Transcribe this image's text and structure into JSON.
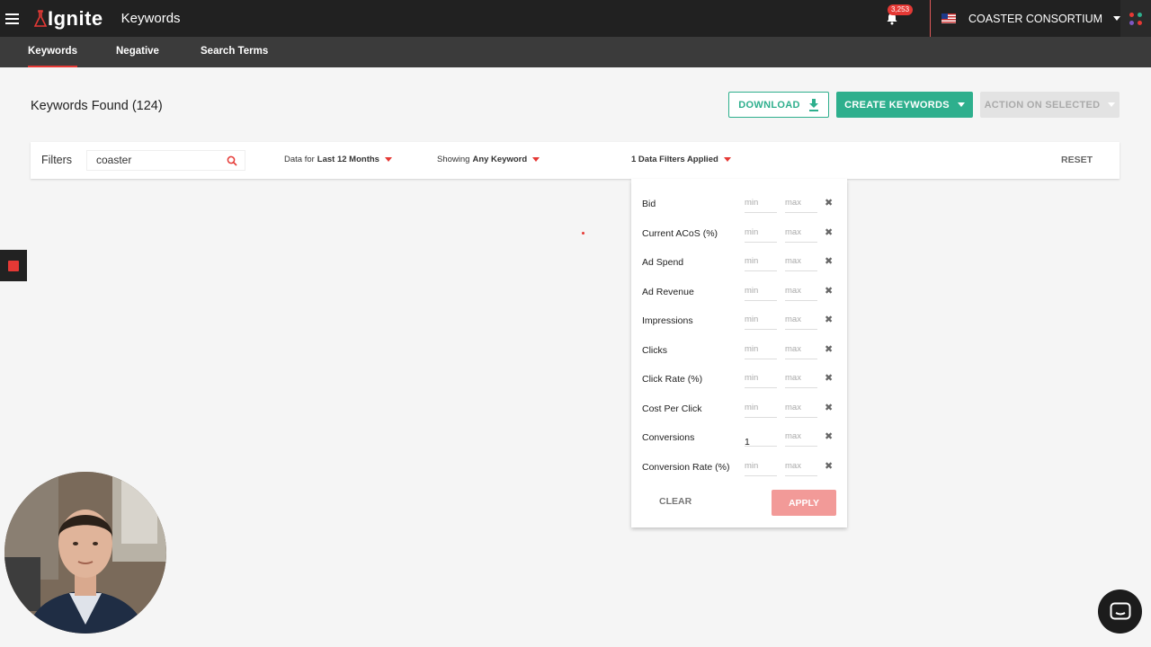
{
  "app": {
    "logo": "Ignite",
    "page_heading": "Keywords",
    "notification_count": "3,253",
    "account_name": "COASTER CONSORTIUM"
  },
  "tabs": [
    {
      "label": "Keywords",
      "active": true
    },
    {
      "label": "Negative",
      "active": false
    },
    {
      "label": "Search Terms",
      "active": false
    }
  ],
  "header": {
    "title": "Keywords Found (124)",
    "download_label": "DOWNLOAD",
    "create_label": "CREATE KEYWORDS",
    "action_label": "ACTION ON SELECTED"
  },
  "filters": {
    "label": "Filters",
    "search_value": "coaster",
    "data_for_prefix": "Data for",
    "data_for_value": "Last 12 Months",
    "showing_prefix": "Showing",
    "showing_value": "Any Keyword",
    "applied_label": "1 Data Filters Applied",
    "reset_label": "RESET"
  },
  "data_filters": {
    "min_placeholder": "min",
    "max_placeholder": "max",
    "rows": [
      {
        "label": "Bid",
        "min": "",
        "max": ""
      },
      {
        "label": "Current ACoS (%)",
        "min": "",
        "max": ""
      },
      {
        "label": "Ad Spend",
        "min": "",
        "max": ""
      },
      {
        "label": "Ad Revenue",
        "min": "",
        "max": ""
      },
      {
        "label": "Impressions",
        "min": "",
        "max": ""
      },
      {
        "label": "Clicks",
        "min": "",
        "max": ""
      },
      {
        "label": "Click Rate (%)",
        "min": "",
        "max": ""
      },
      {
        "label": "Cost Per Click",
        "min": "",
        "max": ""
      },
      {
        "label": "Conversions",
        "min": "1",
        "max": ""
      },
      {
        "label": "Conversion Rate (%)",
        "min": "",
        "max": ""
      }
    ],
    "clear_label": "CLEAR",
    "apply_label": "APPLY"
  },
  "colors": {
    "accent_green": "#2eaf8d",
    "accent_red": "#e53935",
    "topbar": "#212121",
    "subnav": "#3b3b3b"
  },
  "icons": {
    "menu": "hamburger-icon",
    "bell": "bell-icon",
    "flag": "us-flag-icon",
    "apps": "apps-grid-icon",
    "download": "download-icon",
    "search": "search-icon",
    "remove": "close-icon",
    "chat": "chat-icon"
  }
}
